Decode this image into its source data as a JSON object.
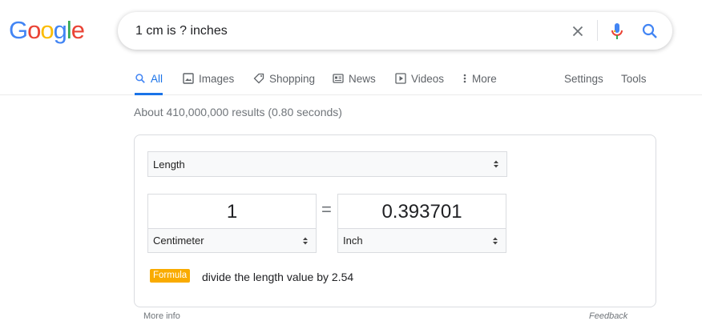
{
  "logo": {
    "letters": [
      "G",
      "o",
      "o",
      "g",
      "l",
      "e"
    ],
    "colors": [
      "#4285f4",
      "#ea4335",
      "#fbbc05",
      "#4285f4",
      "#34a853",
      "#ea4335"
    ]
  },
  "search": {
    "query": "1 cm is ? inches",
    "icons": {
      "clear": "close-icon",
      "voice": "microphone-icon",
      "submit": "search-icon"
    }
  },
  "tabs": [
    {
      "label": "All",
      "icon": "search-icon",
      "active": true
    },
    {
      "label": "Images",
      "icon": "image-icon",
      "active": false
    },
    {
      "label": "Shopping",
      "icon": "tag-icon",
      "active": false
    },
    {
      "label": "News",
      "icon": "newspaper-icon",
      "active": false
    },
    {
      "label": "Videos",
      "icon": "play-icon",
      "active": false
    },
    {
      "label": "More",
      "icon": "more-vert-icon",
      "active": false
    }
  ],
  "tools": {
    "settings_label": "Settings",
    "tools_label": "Tools"
  },
  "result_stats": "About 410,000,000 results (0.80 seconds)",
  "converter": {
    "category": "Length",
    "equals_sign": "=",
    "from": {
      "value": "1",
      "unit": "Centimeter"
    },
    "to": {
      "value": "0.393701",
      "unit": "Inch"
    },
    "formula_badge": "Formula",
    "formula_text": "divide the length value by 2.54"
  },
  "footer": {
    "more_info": "More info",
    "feedback": "Feedback"
  },
  "colors": {
    "accent": "#1a73e8",
    "formula_badge": "#f9ab00",
    "muted_text": "#70757a"
  }
}
